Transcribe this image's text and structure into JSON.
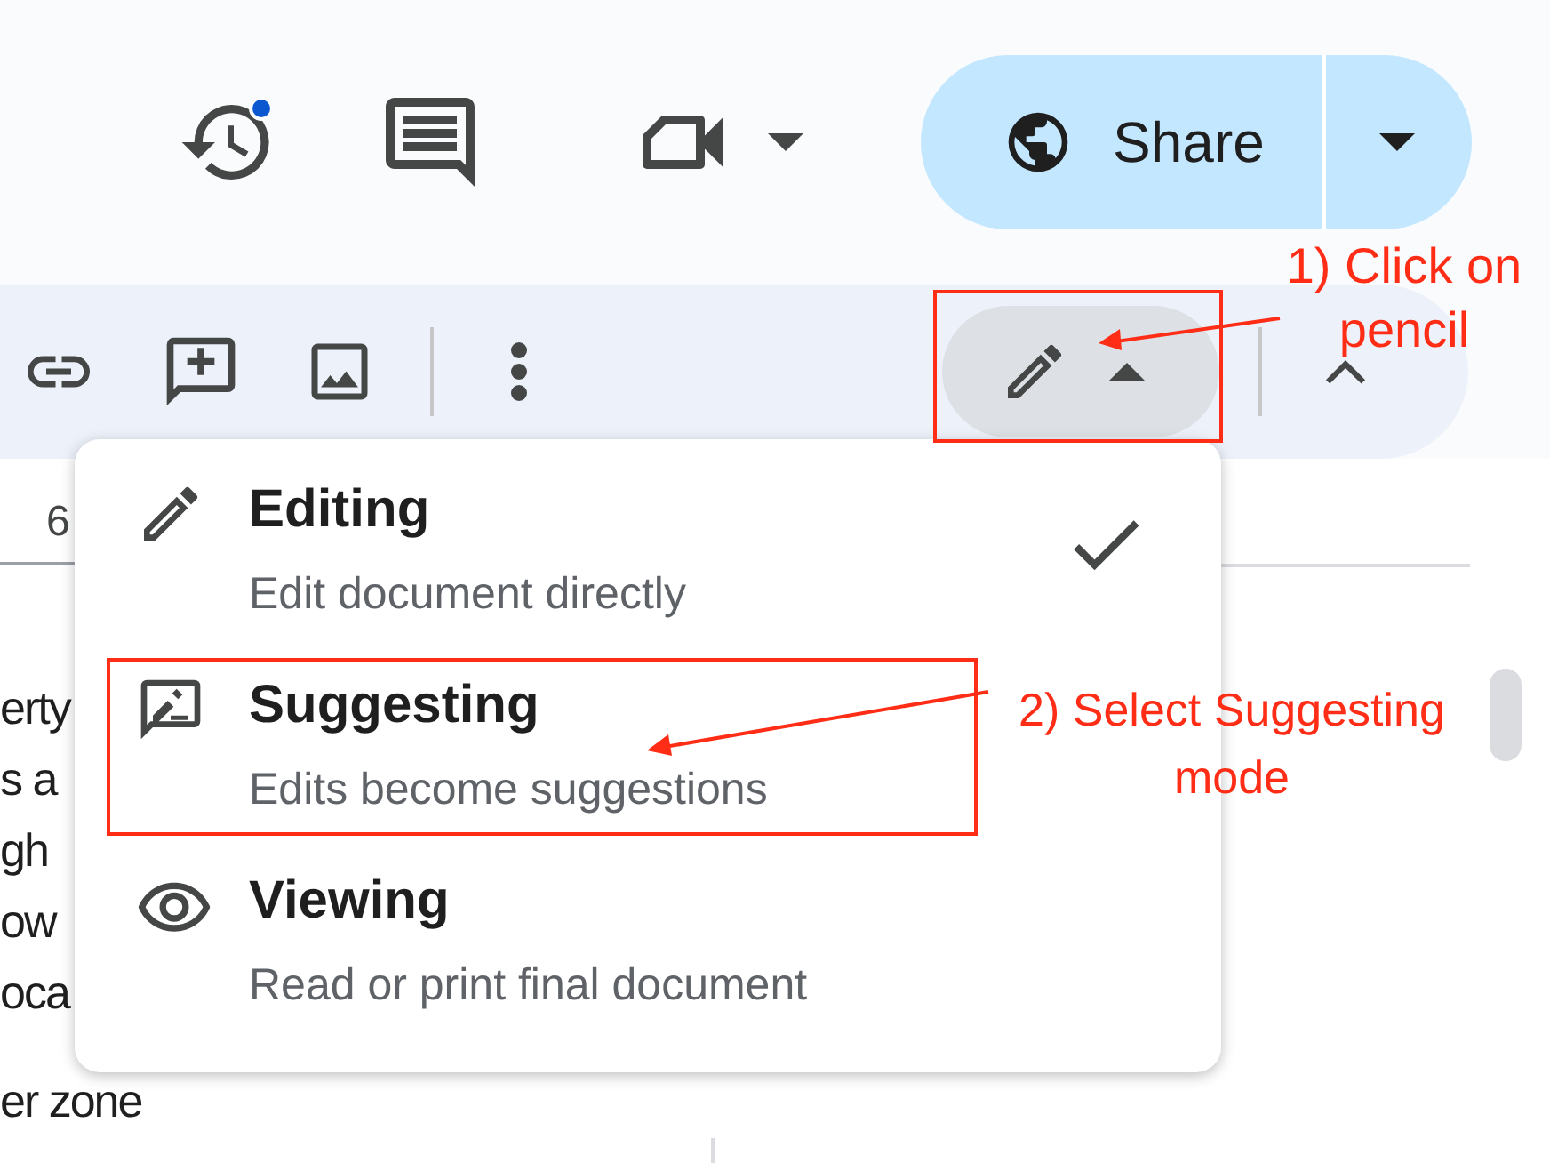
{
  "header": {
    "share_button": {
      "label": "Share"
    }
  },
  "ruler": {
    "label": "6"
  },
  "document": {
    "lines": [
      "erty",
      "s a",
      "gh",
      "ow",
      "oca",
      "er zone"
    ]
  },
  "mode_menu": {
    "items": [
      {
        "kind": "editing",
        "title": "Editing",
        "description": "Edit document directly",
        "selected": true
      },
      {
        "kind": "suggesting",
        "title": "Suggesting",
        "description": "Edits become suggestions",
        "selected": false
      },
      {
        "kind": "viewing",
        "title": "Viewing",
        "description": "Read or print final document",
        "selected": false
      }
    ]
  },
  "annotations": [
    {
      "text": "1) Click on pencil"
    },
    {
      "text": "2) Select Suggesting mode"
    }
  ]
}
